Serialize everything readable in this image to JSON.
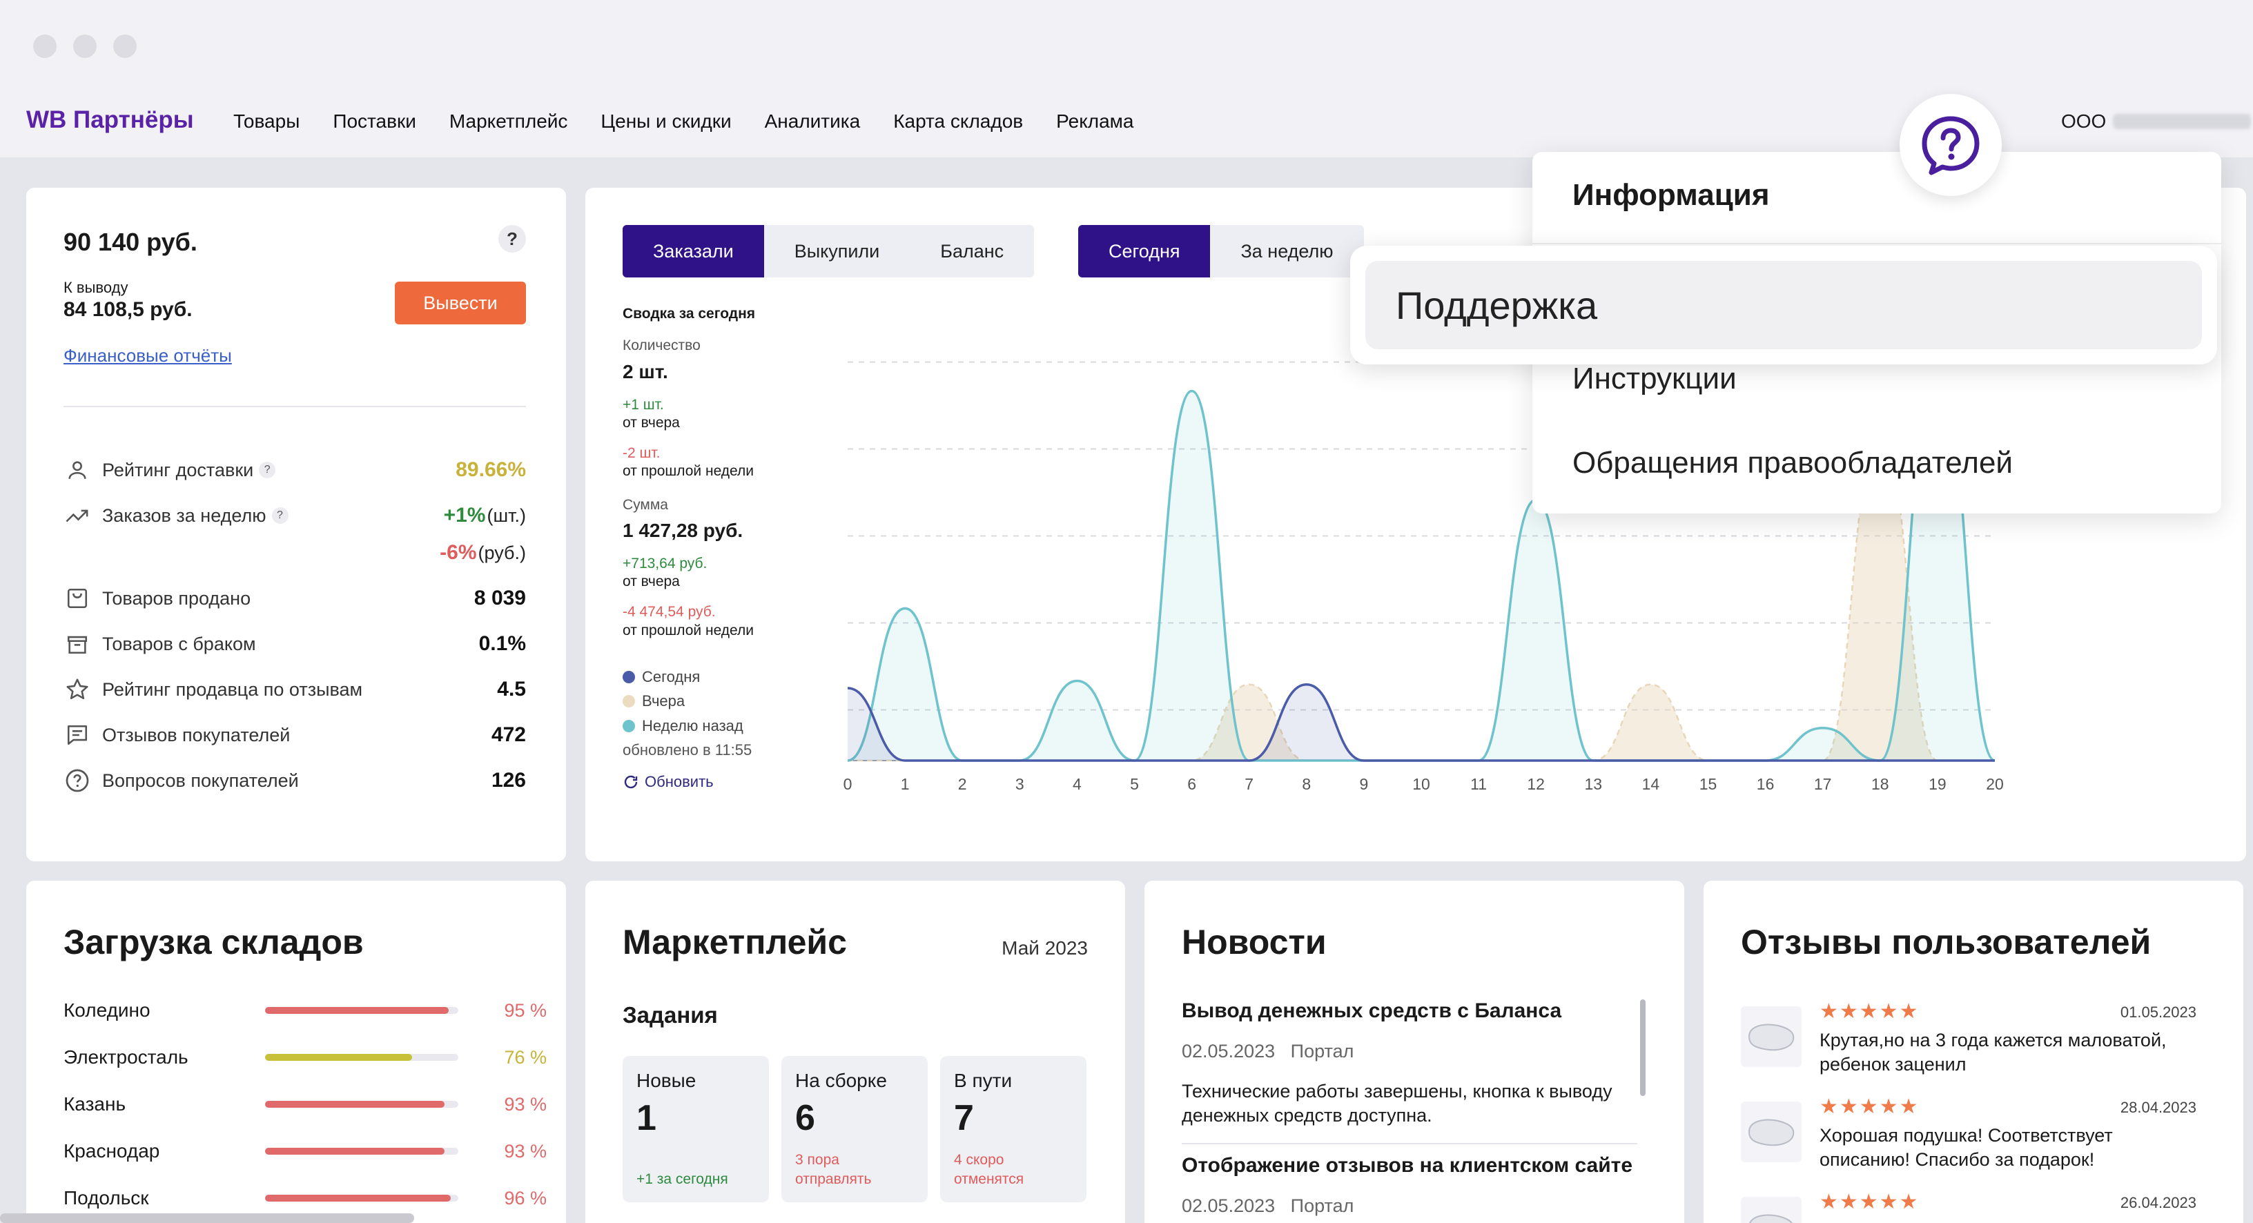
{
  "header": {
    "logo": "WB Партнёры",
    "nav": [
      "Товары",
      "Поставки",
      "Маркетплейс",
      "Цены и скидки",
      "Аналитика",
      "Карта складов",
      "Реклама"
    ],
    "org": "ООО"
  },
  "balance": {
    "amount": "90 140 руб.",
    "help": "?",
    "withdraw_label": "К выводу",
    "withdraw_amount": "84 108,5 руб.",
    "withdraw_button": "Вывести",
    "reports_link": "Финансовые отчёты",
    "stats": [
      {
        "label": "Рейтинг доставки",
        "value": "89.66%"
      },
      {
        "label": "Заказов за неделю",
        "value": "+1%",
        "unit": "(шт.)",
        "value2": "-6%",
        "unit2": "(руб.)"
      },
      {
        "label": "Товаров продано",
        "value": "8 039"
      },
      {
        "label": "Товаров с браком",
        "value": "0.1%"
      },
      {
        "label": "Рейтинг продавца по отзывам",
        "value": "4.5"
      },
      {
        "label": "Отзывов покупателей",
        "value": "472"
      },
      {
        "label": "Вопросов покупателей",
        "value": "126"
      }
    ],
    "colors": {
      "rating": "#c9b23a",
      "positive": "#2e8b3e",
      "negative": "#e05b5b"
    }
  },
  "chart_panel": {
    "tabs_left": [
      "Заказали",
      "Выкупили",
      "Баланс"
    ],
    "tabs_right": [
      "Сегодня",
      "За неделю"
    ],
    "summary_title": "Сводка за сегодня",
    "qty_label": "Количество",
    "qty_value": "2 шт.",
    "qty_delta_day": "+1 шт.",
    "from_yesterday": "от вчера",
    "qty_delta_week": "-2 шт.",
    "from_last_week": "от прошлой недели",
    "sum_label": "Сумма",
    "sum_value": "1 427,28 руб.",
    "sum_delta_day": "+713,64 руб.",
    "sum_delta_week": "-4 474,54 руб.",
    "legend": [
      "Сегодня",
      "Вчера",
      "Неделю назад"
    ],
    "updated": "обновлено в 11:55",
    "refresh": "Обновить"
  },
  "chart_data": {
    "type": "line",
    "x": [
      0,
      1,
      2,
      3,
      4,
      5,
      6,
      7,
      8,
      9,
      10,
      11,
      12,
      13,
      14,
      15,
      16,
      17,
      18,
      19,
      20
    ],
    "x_tick_labels": [
      "0",
      "1",
      "2",
      "3",
      "4",
      "5",
      "6",
      "7",
      "8",
      "9",
      "10",
      "11",
      "12",
      "13",
      "14",
      "15",
      "16",
      "17",
      "18",
      "19",
      "20"
    ],
    "series": [
      {
        "name": "Сегодня",
        "color": "#4a5ba8",
        "values": [
          1,
          0,
          0,
          0,
          0,
          0,
          0,
          0,
          1.05,
          0,
          0,
          0,
          0,
          0,
          0,
          0,
          0,
          0,
          0,
          0,
          0
        ]
      },
      {
        "name": "Вчера",
        "color": "#e8d6b8",
        "values": [
          0,
          0,
          0,
          0,
          0,
          0,
          0,
          1.05,
          0,
          0,
          0,
          0,
          0,
          0,
          1.05,
          0,
          0,
          0,
          4.5,
          0,
          0
        ]
      },
      {
        "name": "Неделю назад",
        "color": "#6fc3cc",
        "values": [
          0,
          2.1,
          0,
          0,
          1.1,
          0,
          5.1,
          0,
          0,
          0,
          0,
          0,
          3.6,
          0,
          0,
          0,
          0,
          0.45,
          0,
          5.5,
          0
        ]
      }
    ],
    "ylim": [
      0,
      6
    ],
    "grid": true
  },
  "dropdown": {
    "title": "Информация",
    "items": [
      "Поддержка",
      "Инструкции",
      "Обращения правообладателей"
    ]
  },
  "warehouses": {
    "title": "Загрузка складов",
    "items": [
      {
        "name": "Коледино",
        "pct": "95 %",
        "level": 0.95,
        "color": "#e06a6a"
      },
      {
        "name": "Электросталь",
        "pct": "76 %",
        "level": 0.76,
        "color": "#c9c03a"
      },
      {
        "name": "Казань",
        "pct": "93 %",
        "level": 0.93,
        "color": "#e06a6a"
      },
      {
        "name": "Краснодар",
        "pct": "93 %",
        "level": 0.93,
        "color": "#e06a6a"
      },
      {
        "name": "Подольск",
        "pct": "96 %",
        "level": 0.96,
        "color": "#e06a6a"
      }
    ],
    "pct_colors": {
      "high": "#e06a6a",
      "mid": "#c9b23a"
    }
  },
  "marketplace": {
    "title": "Маркетплейс",
    "month": "Май 2023",
    "tasks_title": "Задания",
    "tasks": [
      {
        "title": "Новые",
        "count": "1",
        "footer": "+1 за сегодня",
        "footer_color": "#2e8b3e"
      },
      {
        "title": "На сборке",
        "count": "6",
        "footer": "3 пора отправлять",
        "footer_color": "#e05b5b"
      },
      {
        "title": "В пути",
        "count": "7",
        "footer": "4 скоро отменятся",
        "footer_color": "#e05b5b"
      }
    ]
  },
  "news": {
    "title": "Новости",
    "items": [
      {
        "title": "Вывод денежных средств с Баланса",
        "date": "02.05.2023",
        "source": "Портал",
        "text": "Технические работы завершены, кнопка к выводу денежных средств доступна."
      },
      {
        "title": "Отображение отзывов на клиентском сайте",
        "date": "02.05.2023",
        "source": "Портал",
        "text": ""
      }
    ]
  },
  "reviews": {
    "title": "Отзывы пользователей",
    "items": [
      {
        "stars": "★★★★★",
        "date": "01.05.2023",
        "text": "Крутая,но на 3 года кажется маловатой, ребенок заценил"
      },
      {
        "stars": "★★★★★",
        "date": "28.04.2023",
        "text": "Хорошая подушка! Соответствует описанию! Спасибо за подарок!"
      },
      {
        "stars": "★★★★★",
        "date": "26.04.2023",
        "text": ""
      }
    ]
  }
}
